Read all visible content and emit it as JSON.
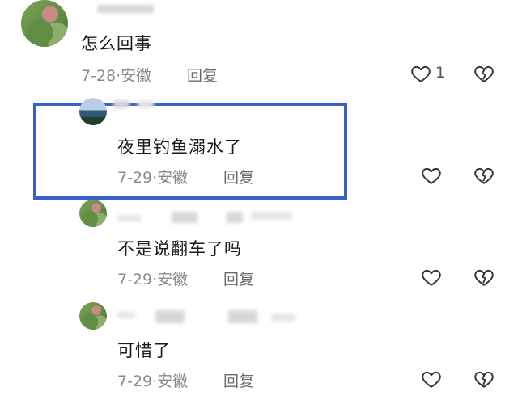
{
  "comments": [
    {
      "text": "怎么回事",
      "date": "7-28",
      "location": "安徽",
      "reply_label": "回复",
      "like_count": "1"
    },
    {
      "text": "夜里钓鱼溺水了",
      "date": "7-29",
      "location": "安徽",
      "reply_label": "回复",
      "highlighted": true
    },
    {
      "text": "不是说翻车了吗",
      "date": "7-29",
      "location": "安徽",
      "reply_label": "回复"
    },
    {
      "text": "可惜了",
      "date": "7-29",
      "location": "安徽",
      "reply_label": "回复"
    }
  ],
  "meta_separator": "·",
  "colors": {
    "highlight_border": "#3a5fc8",
    "meta_text": "#8a8a8a"
  },
  "icons": {
    "like": "heart-icon",
    "dislike": "broken-heart-icon"
  }
}
